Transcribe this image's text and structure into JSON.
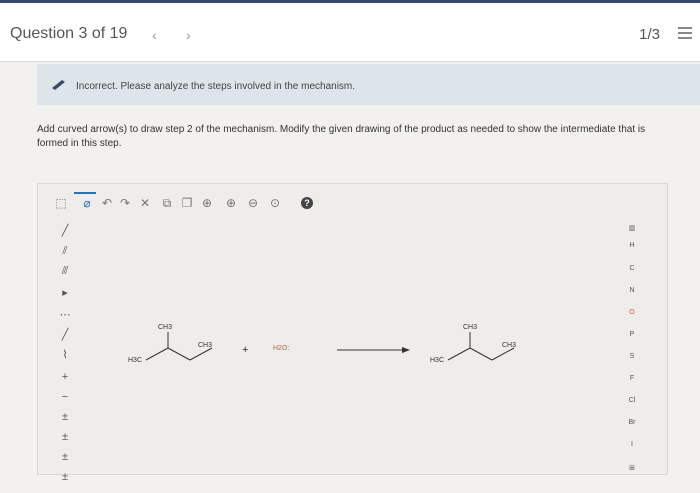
{
  "header": {
    "question_label": "Question 3 of 19",
    "prev_icon": "‹",
    "next_icon": "›",
    "attempts": "1/3"
  },
  "feedback": {
    "message": "Incorrect. Please analyze the steps involved in the mechanism."
  },
  "instructions": {
    "text": "Add curved arrow(s) to draw step 2 of the mechanism. Modify the given drawing of the product as needed to show the intermediate that is formed in this step."
  },
  "toolbar": {
    "help": "?"
  },
  "elements": [
    "H",
    "C",
    "N",
    "O",
    "P",
    "S",
    "F",
    "Cl",
    "Br",
    "I"
  ],
  "molecule": {
    "ch3_top": "CH3",
    "ch3_right": "CH3",
    "h3c_left": "H3C",
    "plus": "+",
    "water": "H2O:",
    "product_ch3_top": "CH3",
    "product_ch3_right": "CH3",
    "product_h3c": "H3C"
  },
  "colors": {
    "accent": "#2a70b8",
    "feedback_bg": "#dde4ea",
    "oxygen": "#d9534f"
  }
}
